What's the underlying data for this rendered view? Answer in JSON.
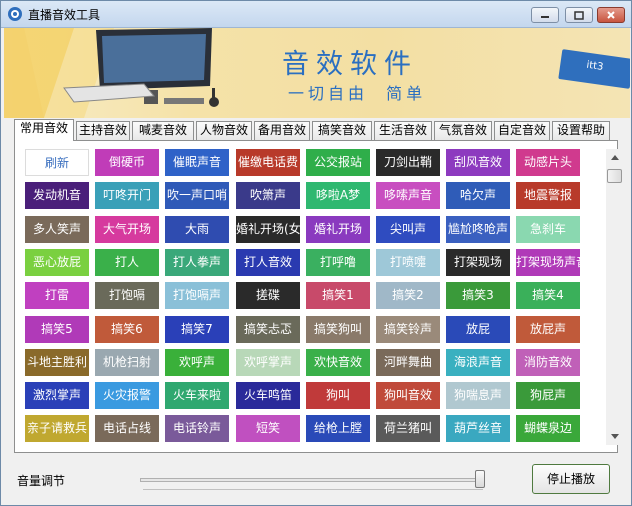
{
  "window": {
    "title": "直播音效工具"
  },
  "banner": {
    "title": "音效软件",
    "subtitle": "一切自由  简单",
    "badge": "itt3"
  },
  "tabs": [
    "常用音效",
    "主持音效",
    "喊麦音效",
    "人物音效",
    "备用音效",
    "搞笑音效",
    "生活音效",
    "气氛音效",
    "自定音效",
    "设置帮助"
  ],
  "active_tab": 0,
  "colors": {
    "window_bg": "#f0f0f0",
    "banner_text": "#2a6fc1",
    "stop_border": "#4f7a3f"
  },
  "buttons": [
    {
      "label": "刷新",
      "color": "#ffffff"
    },
    {
      "label": "倒硬币",
      "color": "#c03cb8"
    },
    {
      "label": "催眠声音",
      "color": "#2f62c8"
    },
    {
      "label": "催缴电话费",
      "color": "#b83a2a"
    },
    {
      "label": "公交报站",
      "color": "#2fae4a"
    },
    {
      "label": "刀剑出鞘",
      "color": "#2a2a2a"
    },
    {
      "label": "刮风音效",
      "color": "#8d3abf"
    },
    {
      "label": "动感片头",
      "color": "#d03a8e"
    },
    {
      "label": "发动机音",
      "color": "#4a1f7a"
    },
    {
      "label": "叮咚开门",
      "color": "#3aa0b8"
    },
    {
      "label": "吹一声口哨",
      "color": "#2f5ab8"
    },
    {
      "label": "吹箫声",
      "color": "#3a3a8a"
    },
    {
      "label": "哆啦A梦",
      "color": "#2fb870"
    },
    {
      "label": "哆嗦声音",
      "color": "#c84ec0"
    },
    {
      "label": "哈欠声",
      "color": "#2f5cb8"
    },
    {
      "label": "地震警报",
      "color": "#b83a2a"
    },
    {
      "label": "多人笑声",
      "color": "#7a6a5a"
    },
    {
      "label": "大气开场",
      "color": "#d63a9e"
    },
    {
      "label": "大雨",
      "color": "#2f4cb0"
    },
    {
      "label": "婚礼开场(女声)",
      "color": "#2a2a2a"
    },
    {
      "label": "婚礼开场",
      "color": "#8a3abf"
    },
    {
      "label": "尖叫声",
      "color": "#2f4cc0"
    },
    {
      "label": "尴尬咚呛声",
      "color": "#3a60c0"
    },
    {
      "label": "急刹车",
      "color": "#8ad8b0"
    },
    {
      "label": "恶心放屁",
      "color": "#7ad040"
    },
    {
      "label": "打人",
      "color": "#3ab04a"
    },
    {
      "label": "打人拳声",
      "color": "#3aa87a"
    },
    {
      "label": "打人音效",
      "color": "#2a3ab0"
    },
    {
      "label": "打呼噜",
      "color": "#3ab060"
    },
    {
      "label": "打喷嚏",
      "color": "#9ec8d8"
    },
    {
      "label": "打架现场",
      "color": "#2a2a2a"
    },
    {
      "label": "打架现场声音",
      "color": "#b03ab8"
    },
    {
      "label": "打雷",
      "color": "#c040c0"
    },
    {
      "label": "打饱嗝",
      "color": "#6a6a5a"
    },
    {
      "label": "打饱嗝声",
      "color": "#8ac0d8"
    },
    {
      "label": "搓碟",
      "color": "#2a2a2a"
    },
    {
      "label": "搞笑1",
      "color": "#c84a6a"
    },
    {
      "label": "搞笑2",
      "color": "#a0b8c8"
    },
    {
      "label": "搞笑3",
      "color": "#3a9a3a"
    },
    {
      "label": "搞笑4",
      "color": "#3ab05a"
    },
    {
      "label": "搞笑5",
      "color": "#b03ab8"
    },
    {
      "label": "搞笑6",
      "color": "#c05a3a"
    },
    {
      "label": "搞笑7",
      "color": "#2a40b8"
    },
    {
      "label": "搞笑忐忑",
      "color": "#6a6a5a"
    },
    {
      "label": "搞笑狗叫",
      "color": "#8a7a6a"
    },
    {
      "label": "搞笑铃声",
      "color": "#9a8a7a"
    },
    {
      "label": "放屁",
      "color": "#2a4ab8"
    },
    {
      "label": "放屁声",
      "color": "#c05a3a"
    },
    {
      "label": "斗地主胜利",
      "color": "#8a6a2a"
    },
    {
      "label": "机枪扫射",
      "color": "#9aa8b0"
    },
    {
      "label": "欢呼声",
      "color": "#3ab03a"
    },
    {
      "label": "欢呼掌声",
      "color": "#b8d8b8"
    },
    {
      "label": "欢快音效",
      "color": "#3ab04a"
    },
    {
      "label": "河畔舞曲",
      "color": "#7a6a5a"
    },
    {
      "label": "海浪声音",
      "color": "#3ab0c0"
    },
    {
      "label": "消防音效",
      "color": "#c060b8"
    },
    {
      "label": "激烈掌声",
      "color": "#2a40b8"
    },
    {
      "label": "火灾报警",
      "color": "#3a9ae0"
    },
    {
      "label": "火车来啦",
      "color": "#2fa870"
    },
    {
      "label": "火车鸣笛",
      "color": "#2a2a9a"
    },
    {
      "label": "狗叫",
      "color": "#c03a3a"
    },
    {
      "label": "狗叫音效",
      "color": "#c04a3a"
    },
    {
      "label": "狗喘息声",
      "color": "#b0c8d0"
    },
    {
      "label": "狗屁声",
      "color": "#3a9a3a"
    },
    {
      "label": "亲子请救兵",
      "color": "#c0a830"
    },
    {
      "label": "电话占线",
      "color": "#7a6a5a"
    },
    {
      "label": "电话铃声",
      "color": "#7a5a9a"
    },
    {
      "label": "短笑",
      "color": "#c050c0"
    },
    {
      "label": "给枪上膛",
      "color": "#2a4ab8"
    },
    {
      "label": "荷兰猪叫",
      "color": "#5a5a5a"
    },
    {
      "label": "葫芦丝音",
      "color": "#3aa8c0"
    },
    {
      "label": "蝴蝶泉边",
      "color": "#3aa83a"
    }
  ],
  "volume": {
    "label": "音量调节",
    "level": 1.0
  },
  "stop_button": "停止播放"
}
